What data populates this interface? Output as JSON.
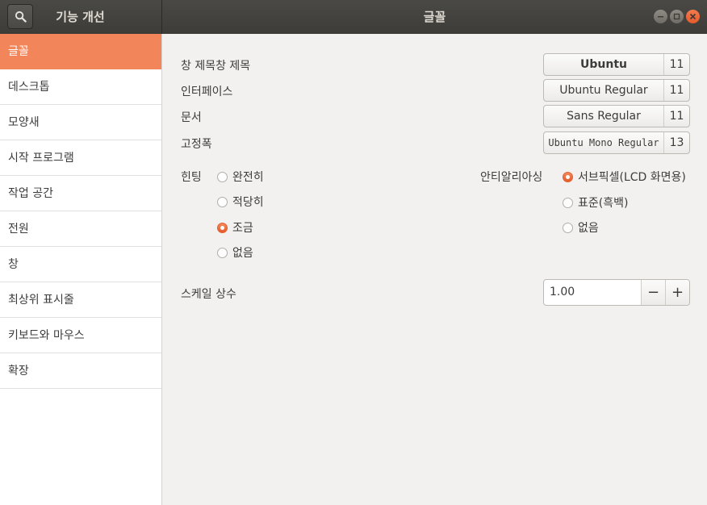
{
  "header": {
    "left_title": "기능 개선",
    "title": "글꼴"
  },
  "sidebar": {
    "items": [
      {
        "label": "글꼴",
        "active": true
      },
      {
        "label": "데스크톱"
      },
      {
        "label": "모양새"
      },
      {
        "label": "시작 프로그램"
      },
      {
        "label": "작업 공간"
      },
      {
        "label": "전원"
      },
      {
        "label": "창"
      },
      {
        "label": "최상위 표시줄"
      },
      {
        "label": "키보드와 마우스"
      },
      {
        "label": "확장"
      }
    ]
  },
  "fonts": {
    "title_label": "창 제목창 제목",
    "title_font": "Ubuntu",
    "title_size": "11",
    "interface_label": "인터페이스",
    "interface_font": "Ubuntu Regular",
    "interface_size": "11",
    "document_label": "문서",
    "document_font": "Sans Regular",
    "document_size": "11",
    "monospace_label": "고정폭",
    "monospace_font": "Ubuntu Mono Regular",
    "monospace_size": "13"
  },
  "hinting": {
    "label": "힌팅",
    "options": [
      "완전히",
      "적당히",
      "조금",
      "없음"
    ],
    "selected": "조금"
  },
  "antialiasing": {
    "label": "안티알리아싱",
    "options": [
      "서브픽셀(LCD 화면용)",
      "표준(흑백)",
      "없음"
    ],
    "selected": "서브픽셀(LCD 화면용)"
  },
  "scale": {
    "label": "스케일 상수",
    "value": "1.00",
    "minus": "−",
    "plus": "+"
  },
  "colors": {
    "accent": "#f2855a",
    "headerbar": "#3d3c38"
  }
}
